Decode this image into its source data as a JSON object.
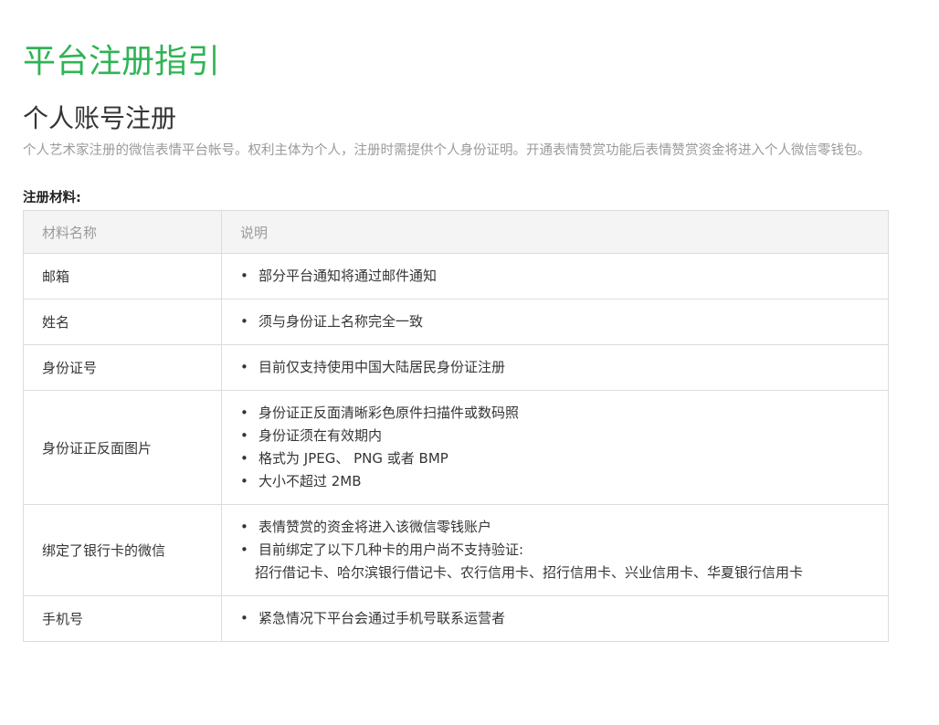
{
  "header": {
    "page_title": "平台注册指引"
  },
  "section": {
    "title": "个人账号注册",
    "description": "个人艺术家注册的微信表情平台帐号。权利主体为个人，注册时需提供个人身份证明。开通表情赞赏功能后表情赞赏资金将进入个人微信零钱包。"
  },
  "materials": {
    "label": "注册材料:",
    "columns": [
      "材料名称",
      "说明"
    ],
    "rows": [
      {
        "name": "邮箱",
        "items": [
          "部分平台通知将通过邮件通知"
        ]
      },
      {
        "name": "姓名",
        "items": [
          "须与身份证上名称完全一致"
        ]
      },
      {
        "name": "身份证号",
        "items": [
          "目前仅支持使用中国大陆居民身份证注册"
        ]
      },
      {
        "name": "身份证正反面图片",
        "items": [
          "身份证正反面清晰彩色原件扫描件或数码照",
          "身份证须在有效期内",
          "格式为 JPEG、 PNG 或者 BMP",
          "大小不超过 2MB"
        ]
      },
      {
        "name": "绑定了银行卡的微信",
        "items": [
          "表情赞赏的资金将进入该微信零钱账户",
          "目前绑定了以下几种卡的用户尚不支持验证:"
        ],
        "continuation": "招行借记卡、哈尔滨银行借记卡、农行信用卡、招行信用卡、兴业信用卡、华夏银行信用卡"
      },
      {
        "name": "手机号",
        "items": [
          "紧急情况下平台会通过手机号联系运营者"
        ]
      }
    ]
  },
  "colors": {
    "title_green": "#2fb455",
    "text_gray": "#9a9a9a",
    "border": "#dcdcdc",
    "header_bg": "#f4f4f4"
  },
  "bullet_symbol": "•"
}
